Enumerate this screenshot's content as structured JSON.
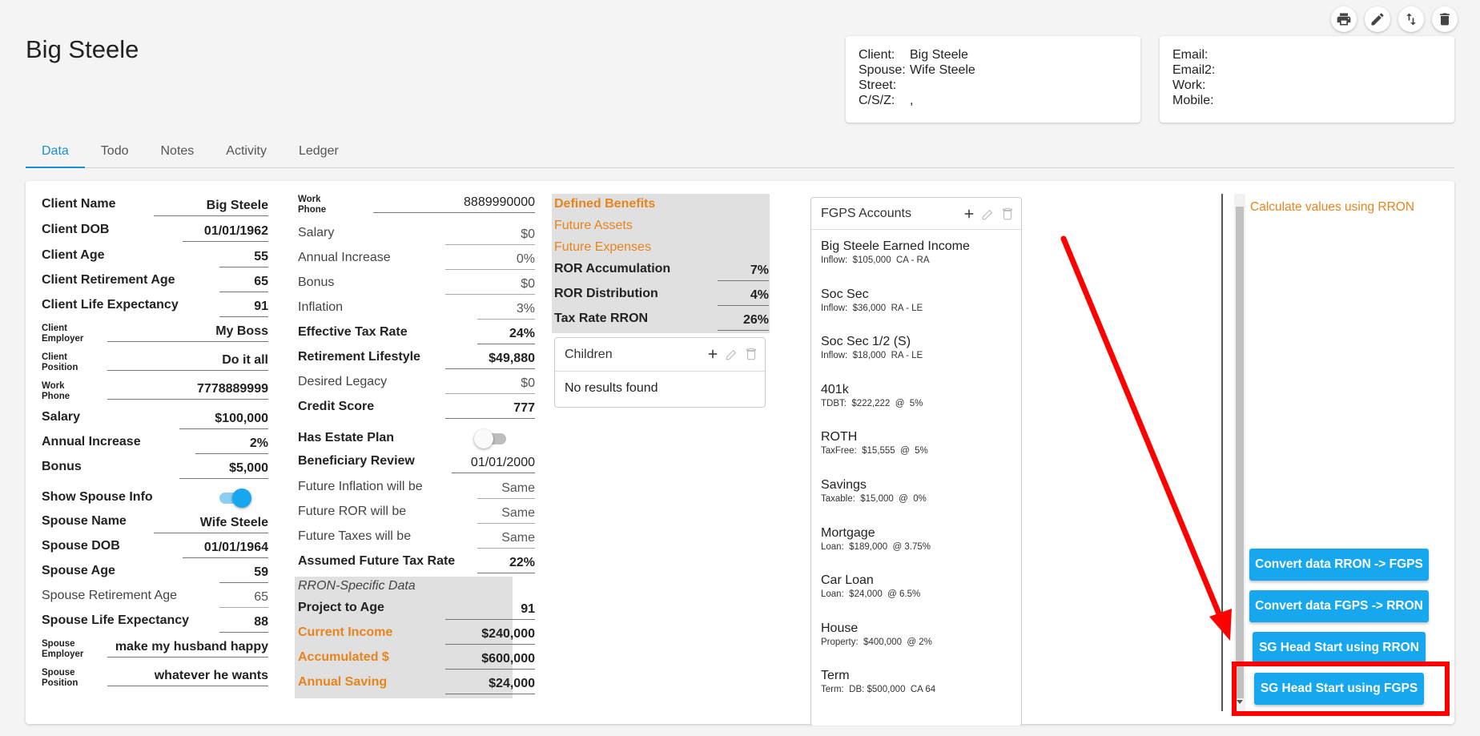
{
  "page": {
    "title": "Big Steele"
  },
  "toolbar": {
    "icons": [
      "print-icon",
      "edit-icon",
      "sort-icon",
      "delete-icon"
    ]
  },
  "client_card": {
    "rows": [
      {
        "k": "Client:",
        "v": "Big Steele"
      },
      {
        "k": "Spouse:",
        "v": "Wife Steele"
      },
      {
        "k": "Street:",
        "v": ""
      },
      {
        "k": "C/S/Z:",
        "v": ","
      }
    ]
  },
  "contact_card": {
    "rows": [
      {
        "k": "Email:",
        "v": ""
      },
      {
        "k": "Email2:",
        "v": ""
      },
      {
        "k": "Work:",
        "v": ""
      },
      {
        "k": "Mobile:",
        "v": ""
      }
    ]
  },
  "tabs": [
    "Data",
    "Todo",
    "Notes",
    "Activity",
    "Ledger"
  ],
  "col1": {
    "client_name": {
      "label": "Client Name",
      "value": "Big Steele"
    },
    "client_dob": {
      "label": "Client DOB",
      "value": "01/01/1962"
    },
    "client_age": {
      "label": "Client Age",
      "value": "55"
    },
    "client_ret_age": {
      "label": "Client Retirement Age",
      "value": "65"
    },
    "client_life": {
      "label": "Client Life Expectancy",
      "value": "91"
    },
    "client_employer": {
      "label1": "Client",
      "label2": "Employer",
      "value": "My Boss"
    },
    "client_position": {
      "label1": "Client",
      "label2": "Position",
      "value": "Do it all"
    },
    "work_phone": {
      "label1": "Work",
      "label2": "Phone",
      "value": "7778889999"
    },
    "salary": {
      "label": "Salary",
      "value": "$100,000"
    },
    "annual_increase": {
      "label": "Annual Increase",
      "value": "2%"
    },
    "bonus": {
      "label": "Bonus",
      "value": "$5,000"
    },
    "show_spouse": {
      "label": "Show Spouse Info",
      "on": true
    },
    "spouse_name": {
      "label": "Spouse Name",
      "value": "Wife Steele"
    },
    "spouse_dob": {
      "label": "Spouse DOB",
      "value": "01/01/1964"
    },
    "spouse_age": {
      "label": "Spouse Age",
      "value": "59"
    },
    "spouse_ret_age": {
      "label": "Spouse Retirement Age",
      "value": "65"
    },
    "spouse_life": {
      "label": "Spouse Life Expectancy",
      "value": "88"
    },
    "spouse_employer": {
      "label1": "Spouse",
      "label2": "Employer",
      "value": "make my husband happy"
    },
    "spouse_position": {
      "label1": "Spouse",
      "label2": "Position",
      "value": "whatever he wants"
    }
  },
  "col2": {
    "work_phone": {
      "label1": "Work",
      "label2": "Phone",
      "value": "8889990000"
    },
    "salary": {
      "label": "Salary",
      "value": "$0"
    },
    "annual_increase": {
      "label": "Annual Increase",
      "value": "0%"
    },
    "bonus": {
      "label": "Bonus",
      "value": "$0"
    },
    "inflation": {
      "label": "Inflation",
      "value": "3%"
    },
    "eff_tax": {
      "label": "Effective Tax Rate",
      "value": "24%"
    },
    "ret_lifestyle": {
      "label": "Retirement Lifestyle",
      "value": "$49,880"
    },
    "legacy": {
      "label": "Desired Legacy",
      "value": "$0"
    },
    "credit": {
      "label": "Credit Score",
      "value": "777"
    },
    "estate_plan": {
      "label": "Has Estate Plan",
      "on": false
    },
    "beneficiary": {
      "label": "Beneficiary Review",
      "value": "01/01/2000"
    },
    "future_inflation": {
      "label": "Future Inflation will be",
      "value": "Same"
    },
    "future_ror": {
      "label": "Future ROR will be",
      "value": "Same"
    },
    "future_taxes": {
      "label": "Future Taxes will be",
      "value": "Same"
    },
    "assumed_tax": {
      "label": "Assumed Future Tax Rate",
      "value": "22%"
    },
    "rron_header": "RRON-Specific Data",
    "project_age": {
      "label": "Project to Age",
      "value": "91"
    },
    "current_income": {
      "label": "Current Income",
      "value": "$240,000"
    },
    "accumulated": {
      "label": "Accumulated $",
      "value": "$600,000"
    },
    "annual_saving": {
      "label": "Annual Saving",
      "value": "$24,000"
    }
  },
  "col3": {
    "links": [
      "Defined Benefits",
      "Future Assets",
      "Future Expenses"
    ],
    "ror_acc": {
      "label": "ROR Accumulation",
      "value": "7%"
    },
    "ror_dist": {
      "label": "ROR Distribution",
      "value": "4%"
    },
    "tax_rron": {
      "label": "Tax Rate RRON",
      "value": "26%"
    },
    "children": {
      "title": "Children",
      "empty": "No results found"
    }
  },
  "fgps": {
    "title": "FGPS Accounts",
    "accounts": [
      {
        "name": "Big Steele Earned Income",
        "sub": "Inflow:  $105,000  CA - RA"
      },
      {
        "name": "Soc Sec",
        "sub": "Inflow:  $36,000  RA - LE"
      },
      {
        "name": "Soc Sec 1/2 (S)",
        "sub": "Inflow:  $18,000  RA - LE"
      },
      {
        "name": "401k",
        "sub": "TDBT:  $222,222  @  5%"
      },
      {
        "name": "ROTH",
        "sub": "TaxFree:  $15,555  @  5%"
      },
      {
        "name": "Savings",
        "sub": "Taxable:  $15,000  @  0%"
      },
      {
        "name": "Mortgage",
        "sub": "Loan:  $189,000  @ 3.75%"
      },
      {
        "name": "Car Loan",
        "sub": "Loan:  $24,000  @ 6.5%"
      },
      {
        "name": "House",
        "sub": "Property:  $400,000  @ 2%"
      },
      {
        "name": "Term",
        "sub": "Term:  DB: $500,000  CA 64"
      }
    ]
  },
  "right": {
    "calc_link": "Calculate values using RRON",
    "buttons": [
      "Convert data RRON -> FGPS",
      "Convert data FGPS -> RRON",
      "SG Head Start using RRON",
      "SG Head Start using FGPS"
    ]
  },
  "colors": {
    "accent": "#17a7ef",
    "orange": "#e8841c",
    "annotation": "#ff0000"
  }
}
